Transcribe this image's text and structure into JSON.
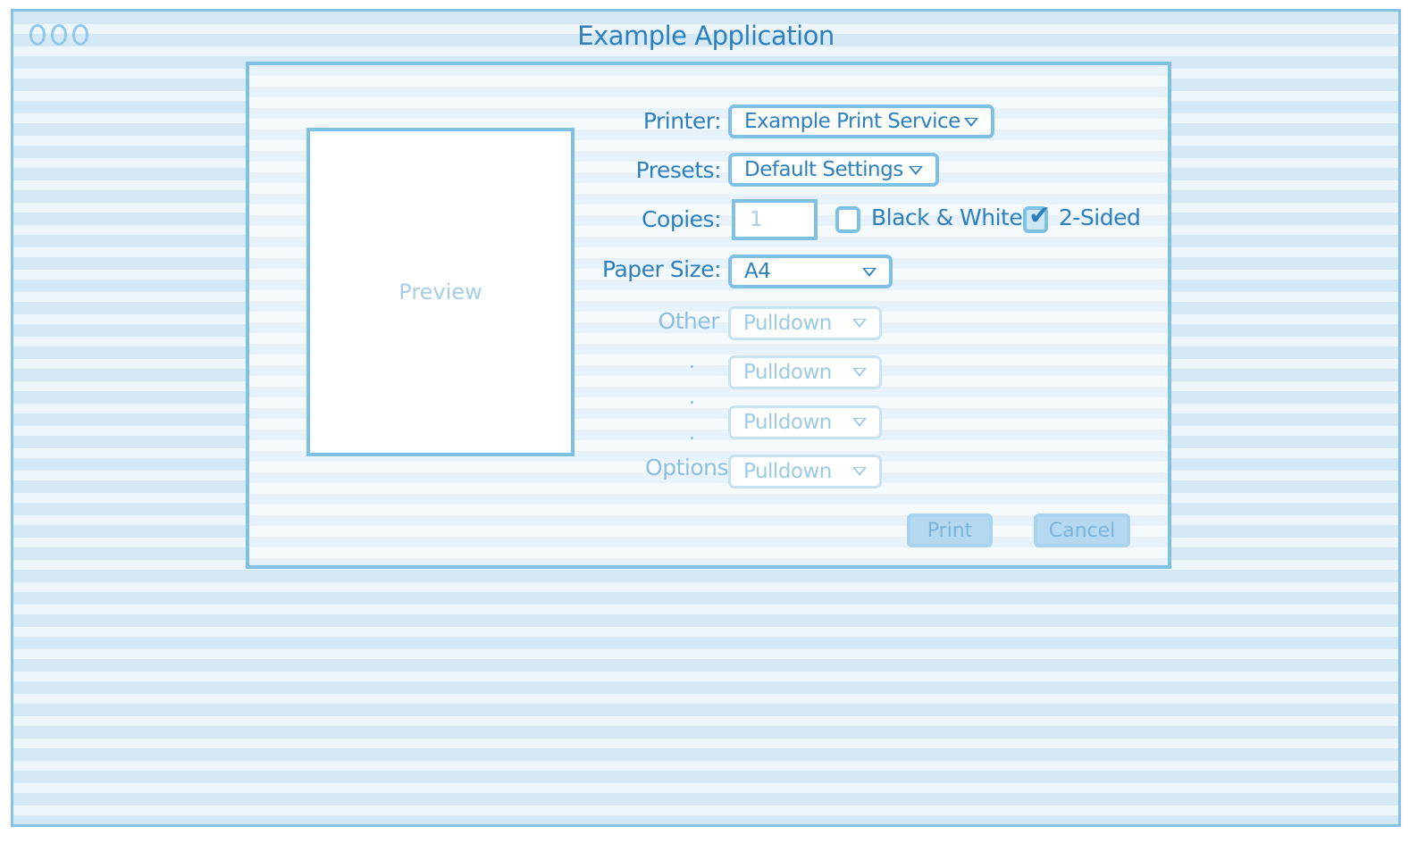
{
  "window": {
    "title": "Example Application"
  },
  "dialog": {
    "preview_label": "Preview",
    "printer": {
      "label": "Printer:",
      "value": "Example Print Service"
    },
    "presets": {
      "label": "Presets:",
      "value": "Default Settings"
    },
    "copies": {
      "label": "Copies:",
      "value": "1"
    },
    "black_white": {
      "label": "Black & White",
      "checked": false
    },
    "two_sided": {
      "label": "2-Sided",
      "checked": true
    },
    "paper_size": {
      "label": "Paper Size:",
      "value": "A4"
    },
    "other_label": "Other",
    "options_label": "Options",
    "pulldowns": [
      "Pulldown",
      "Pulldown",
      "Pulldown",
      "Pulldown"
    ],
    "print_button": "Print",
    "cancel_button": "Cancel"
  },
  "colors": {
    "accent": "#2d7fbe",
    "border": "#7fc1e6",
    "background_stripe": "#d4e8f6"
  }
}
